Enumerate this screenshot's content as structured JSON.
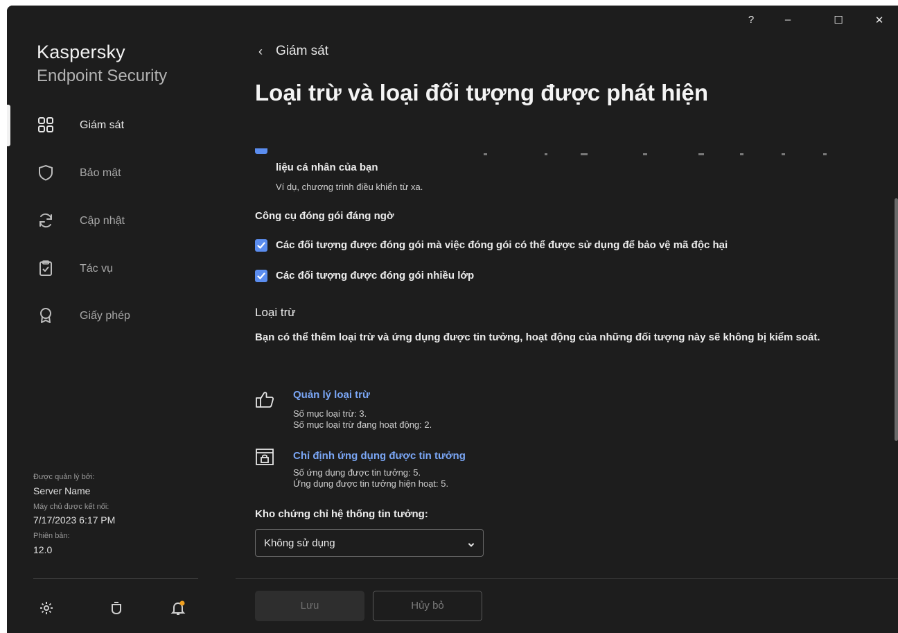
{
  "app": {
    "brand_top": "Kaspersky",
    "brand_bottom": "Endpoint Security"
  },
  "titlebar": {
    "help": "?",
    "minimize": "–",
    "maximize": "☐",
    "close": "✕"
  },
  "sidebar": {
    "items": [
      {
        "label": "Giám sát",
        "icon": "grid-icon",
        "active": true
      },
      {
        "label": "Bảo mật",
        "icon": "shield-icon",
        "active": false
      },
      {
        "label": "Cập nhật",
        "icon": "refresh-icon",
        "active": false
      },
      {
        "label": "Tác vụ",
        "icon": "clipboard-check-icon",
        "active": false
      },
      {
        "label": "Giấy phép",
        "icon": "award-icon",
        "active": false
      }
    ],
    "meta": {
      "managed_by_label": "Được quản lý bởi:",
      "managed_by_value": "Server Name",
      "connected_label": "Máy chủ được kết nối:",
      "connected_value": "7/17/2023 6:17 PM",
      "version_label": "Phiên bản:",
      "version_value": "12.0"
    },
    "bottom_icons": [
      "settings-icon",
      "support-icon",
      "notifications-icon"
    ],
    "notification_dot_color": "#f0a020"
  },
  "main": {
    "back_label": "Giám sát",
    "title": "Loại trừ và loại đối tượng được phát hiện",
    "partial_item": {
      "label": "liệu cá nhân của bạn",
      "description": "Ví dụ, chương trình điều khiển từ xa."
    },
    "packers_heading": "Công cụ đóng gói đáng ngờ",
    "checkboxes": [
      {
        "label": "Các đối tượng được đóng gói mà việc đóng gói có thể được sử dụng để bảo vệ mã độc hại",
        "checked": true
      },
      {
        "label": "Các đối tượng được đóng gói nhiều lớp",
        "checked": true
      }
    ],
    "exclusions_heading": "Loại trừ",
    "exclusions_desc": "Bạn có thể thêm loại trừ và ứng dụng được tin tưởng, hoạt động của những đối tượng này sẽ không bị kiểm soát.",
    "manage_exclusions": {
      "link": "Quản lý loại trừ",
      "line1": "Số mục loại trừ: 3.",
      "line2": "Số mục loại trừ đang hoạt động: 2."
    },
    "trusted_apps": {
      "link": "Chỉ định ứng dụng được tin tưởng",
      "line1": "Số ứng dụng được tin tưởng: 5.",
      "line2": "Ứng dụng được tin tưởng hiện hoạt: 5."
    },
    "cert_store_label": "Kho chứng chỉ hệ thống tin tưởng:",
    "cert_store_value": "Không sử dụng"
  },
  "footer": {
    "save": "Lưu",
    "cancel": "Hủy bỏ"
  },
  "colors": {
    "background": "#1d1d1d",
    "accent": "#5b8def",
    "link": "#7aa6f5"
  }
}
